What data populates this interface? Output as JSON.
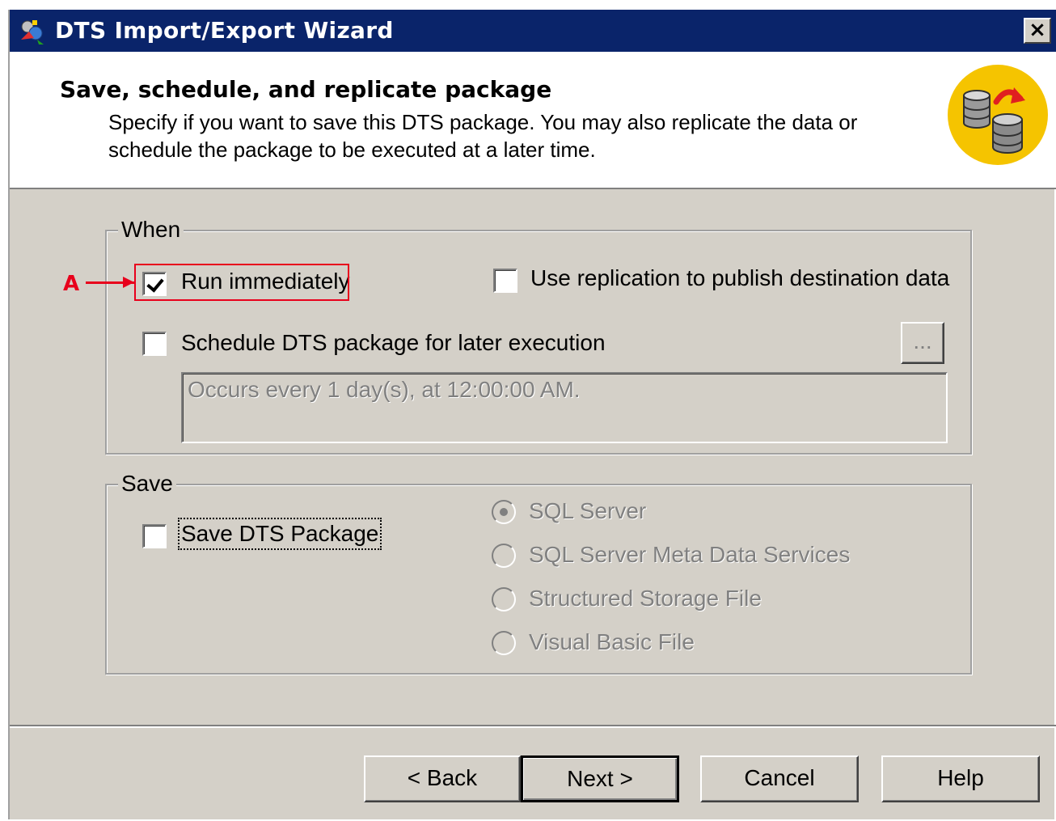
{
  "window": {
    "title": "DTS Import/Export Wizard",
    "close_label": "×"
  },
  "header": {
    "title": "Save, schedule, and replicate package",
    "description": "Specify if you want to save this DTS package.  You may also replicate the data or schedule the package to be executed at a later time."
  },
  "when_group": {
    "label": "When",
    "run_immediately": {
      "label": "Run immediately",
      "checked": true
    },
    "use_replication": {
      "label": "Use replication to publish destination data",
      "checked": false
    },
    "schedule": {
      "label": "Schedule DTS package for later execution",
      "checked": false
    },
    "schedule_button_label": "...",
    "schedule_text": "Occurs every 1 day(s), at 12:00:00 AM."
  },
  "save_group": {
    "label": "Save",
    "save_package": {
      "label": "Save DTS Package",
      "checked": false
    },
    "options": [
      {
        "label": "SQL Server",
        "selected": true
      },
      {
        "label": "SQL Server Meta Data Services",
        "selected": false
      },
      {
        "label": "Structured Storage File",
        "selected": false
      },
      {
        "label": "Visual Basic File",
        "selected": false
      }
    ]
  },
  "buttons": {
    "back": "< Back",
    "next": "Next >",
    "cancel": "Cancel",
    "help": "Help"
  },
  "annotation": {
    "marker": "A",
    "color": "#e8001c"
  },
  "colors": {
    "titlebar": "#0a246a",
    "face": "#d4d0c8",
    "logo": "#f5c400"
  }
}
